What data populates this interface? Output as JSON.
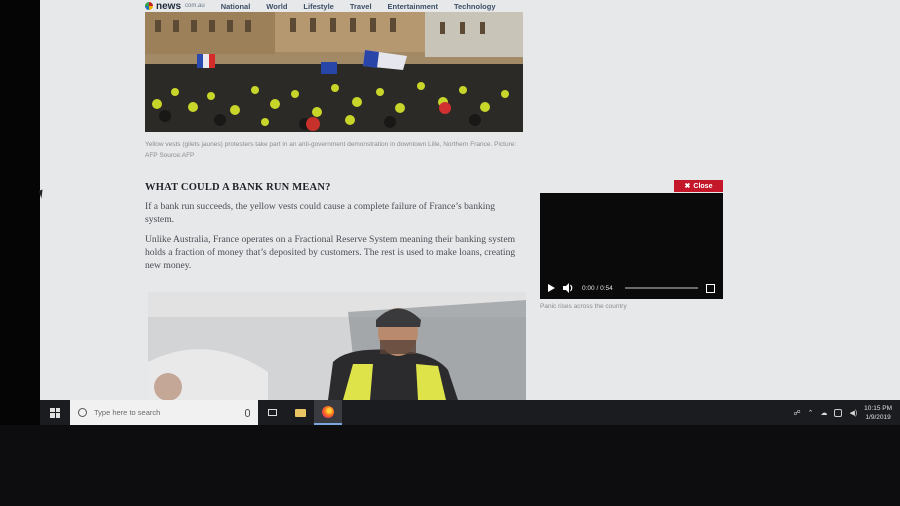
{
  "site": {
    "logo_text": "news",
    "logo_sub": "com.au",
    "nav": [
      "National",
      "World",
      "Lifestyle",
      "Travel",
      "Entertainment",
      "Technology"
    ]
  },
  "hero": {
    "caption": "Yellow vests (gilets jaunes) protesters take part in an anti-government demonstration in downtown Lille, Northern France. Picture: AFP Source:AFP"
  },
  "article": {
    "heading": "WHAT COULD A BANK RUN MEAN?",
    "paragraphs": [
      "If a bank run succeeds, the yellow vests could cause a complete failure of France’s banking system.",
      "Unlike Australia, France operates on a Fractional Reserve System meaning their banking system holds a fraction of money that’s deposited by customers. The rest is used to make loans, creating new money."
    ]
  },
  "video": {
    "close_label": "Close",
    "current_time": "0:00",
    "separator": "/",
    "duration": "0:54",
    "caption": "Panic rises across the country"
  },
  "taskbar": {
    "search_placeholder": "Type here to search",
    "time": "10:15 PM",
    "date": "1/9/2019"
  },
  "colors": {
    "close_red": "#c4182a",
    "taskbar": "#1b1c1f"
  }
}
